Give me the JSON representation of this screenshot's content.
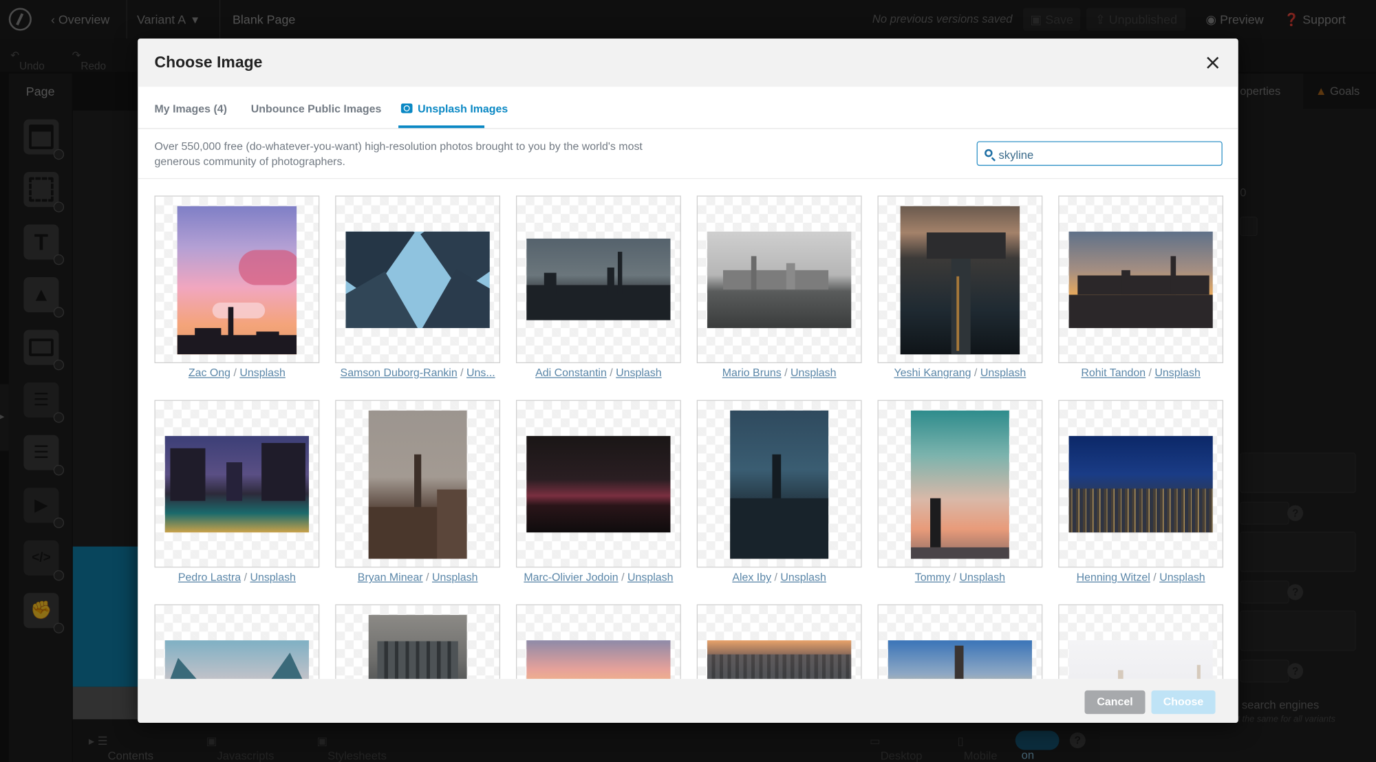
{
  "app": {
    "nav": {
      "overview": "Overview",
      "variant": "Variant A",
      "page": "Blank Page"
    },
    "status": "No previous versions saved",
    "save": "Save",
    "unpublished": "Unpublished",
    "preview": "Preview",
    "support": "Support",
    "undo": "Undo",
    "redo": "Redo",
    "left_panel_title": "Page",
    "right_tabs": {
      "properties": "operties",
      "goals": "Goals"
    },
    "right_fragments": {
      "search_engines": "search engines",
      "note": "t the same for all variants",
      "zero": "0"
    },
    "bottom": {
      "contents": "Contents",
      "javascripts": "Javascripts",
      "stylesheets": "Stylesheets",
      "desktop": "Desktop",
      "mobile": "Mobile",
      "toggle": "on"
    }
  },
  "modal": {
    "title": "Choose Image",
    "tabs": [
      {
        "label": "My Images (4)",
        "active": false
      },
      {
        "label": "Unbounce Public Images",
        "active": false
      },
      {
        "label": "Unsplash Images",
        "active": true
      }
    ],
    "description": "Over 550,000 free (do-whatever-you-want) high-resolution photos brought to you by the world's most generous community of photographers.",
    "search": {
      "value": "skyline"
    },
    "source": "Unsplash",
    "images": [
      {
        "author": "Zac Ong",
        "source": "Unsplash"
      },
      {
        "author": "Samson Duborg-Rankin",
        "source": "Uns..."
      },
      {
        "author": "Adi Constantin",
        "source": "Unsplash"
      },
      {
        "author": "Mario Bruns",
        "source": "Unsplash"
      },
      {
        "author": "Yeshi Kangrang",
        "source": "Unsplash"
      },
      {
        "author": "Rohit Tandon",
        "source": "Unsplash"
      },
      {
        "author": "Pedro Lastra",
        "source": "Unsplash"
      },
      {
        "author": "Bryan Minear",
        "source": "Unsplash"
      },
      {
        "author": "Marc-Olivier Jodoin",
        "source": "Unsplash"
      },
      {
        "author": "Alex Iby",
        "source": "Unsplash"
      },
      {
        "author": "Tommy",
        "source": "Unsplash"
      },
      {
        "author": "Henning Witzel",
        "source": "Unsplash"
      }
    ],
    "footer": {
      "cancel": "Cancel",
      "choose": "Choose"
    }
  },
  "colors": {
    "accent": "#0a88c4",
    "link": "#5a86a8",
    "cancel_bg": "#a7a9ac",
    "choose_bg": "#bfe3f6"
  }
}
